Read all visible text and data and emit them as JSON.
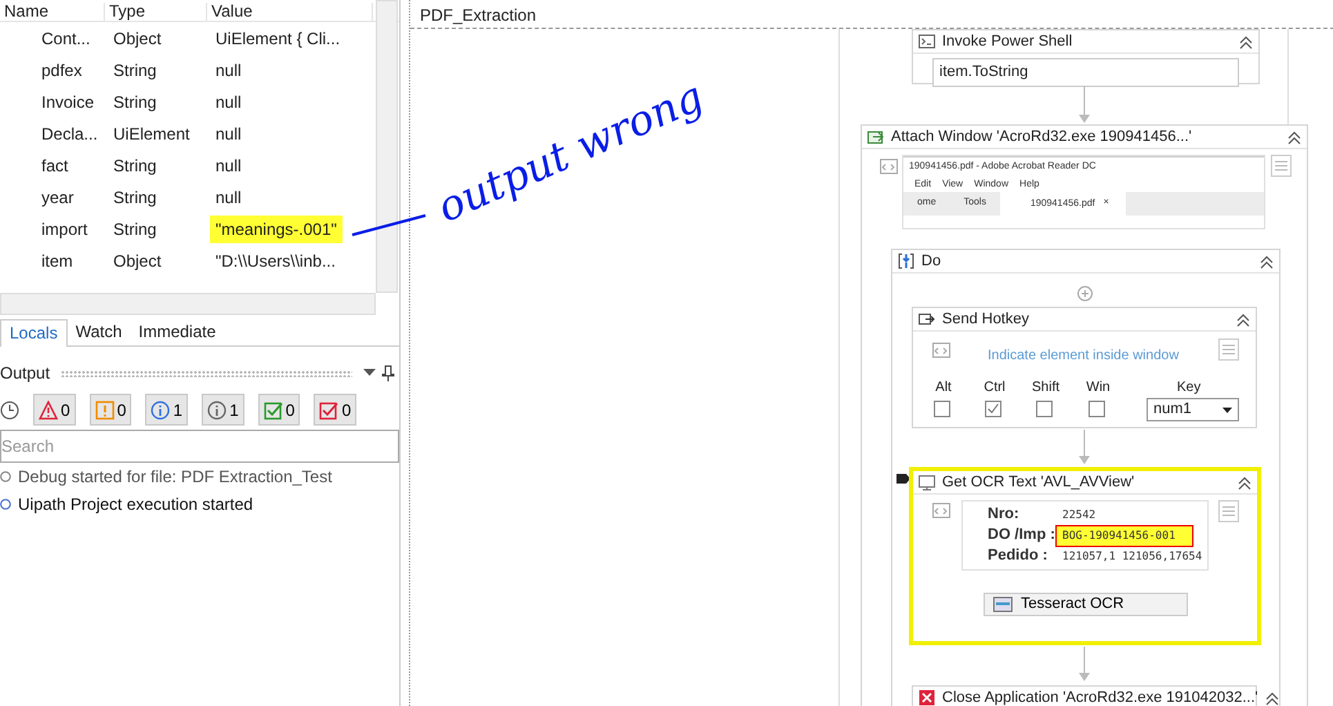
{
  "locals": {
    "columns": [
      "Name",
      "Type",
      "Value"
    ],
    "rows": [
      {
        "name": "Cont...",
        "type": "Object",
        "value": "UiElement { Cli...",
        "highlighted": false
      },
      {
        "name": "pdfex",
        "type": "String",
        "value": "null",
        "highlighted": false
      },
      {
        "name": "Invoice",
        "type": "String",
        "value": "null",
        "highlighted": false
      },
      {
        "name": "Decla...",
        "type": "UiElement",
        "value": "null",
        "highlighted": false
      },
      {
        "name": "fact",
        "type": "String",
        "value": "null",
        "highlighted": false
      },
      {
        "name": "year",
        "type": "String",
        "value": "null",
        "highlighted": false
      },
      {
        "name": "import",
        "type": "String",
        "value": "\"meanings-.001\"",
        "highlighted": true
      },
      {
        "name": "item",
        "type": "Object",
        "value": "\"D:\\\\Users\\\\inb...",
        "highlighted": false
      }
    ]
  },
  "debug_tabs": [
    {
      "label": "Locals",
      "selected": true
    },
    {
      "label": "Watch",
      "selected": false
    },
    {
      "label": "Immediate",
      "selected": false
    }
  ],
  "output": {
    "title": "Output",
    "filters": [
      {
        "kind": "error",
        "count": "0"
      },
      {
        "kind": "warning",
        "count": "0"
      },
      {
        "kind": "info",
        "count": "1"
      },
      {
        "kind": "trace",
        "count": "1"
      },
      {
        "kind": "success",
        "count": "0"
      },
      {
        "kind": "failure",
        "count": "0"
      }
    ],
    "search": {
      "placeholder": "Search"
    },
    "log": [
      {
        "kind": "debug",
        "text": "Debug started for file: PDF Extraction_Test"
      },
      {
        "kind": "info",
        "text": "Uipath Project execution started"
      }
    ]
  },
  "annotation": {
    "text": "output wrong"
  },
  "designer": {
    "title": "PDF_Extraction",
    "invoke_power_shell": {
      "title": "Invoke Power Shell",
      "input": "item.ToString"
    },
    "attach_window": {
      "title": "Attach Window 'AcroRd32.exe 190941456...'",
      "screenshot": {
        "title": "190941456.pdf - Adobe Acrobat Reader DC",
        "menu": [
          "Edit",
          "View",
          "Window",
          "Help"
        ],
        "tabs": [
          "ome",
          "Tools",
          "190941456.pdf"
        ],
        "close": "×"
      }
    },
    "do": {
      "title": "Do"
    },
    "send_hotkey": {
      "title": "Send Hotkey",
      "hint": "Indicate element inside window",
      "modifiers": [
        {
          "label": "Alt",
          "checked": false
        },
        {
          "label": "Ctrl",
          "checked": true
        },
        {
          "label": "Shift",
          "checked": false
        },
        {
          "label": "Win",
          "checked": false
        }
      ],
      "key_label": "Key",
      "key": "num1"
    },
    "get_ocr_text": {
      "title": "Get OCR Text 'AVL_AVView'",
      "selected": true,
      "fields": [
        {
          "label": "Nro:",
          "value": "22542",
          "highlighted": false
        },
        {
          "label": "DO /Imp :",
          "value": "BOG-190941456-001",
          "highlighted": true
        },
        {
          "label": "Pedido :",
          "value": "121057,1 121056,17654",
          "highlighted": false
        }
      ],
      "engine": "Tesseract OCR"
    },
    "close_application": {
      "title": "Close Application 'AcroRd32.exe 191042032...'"
    }
  }
}
